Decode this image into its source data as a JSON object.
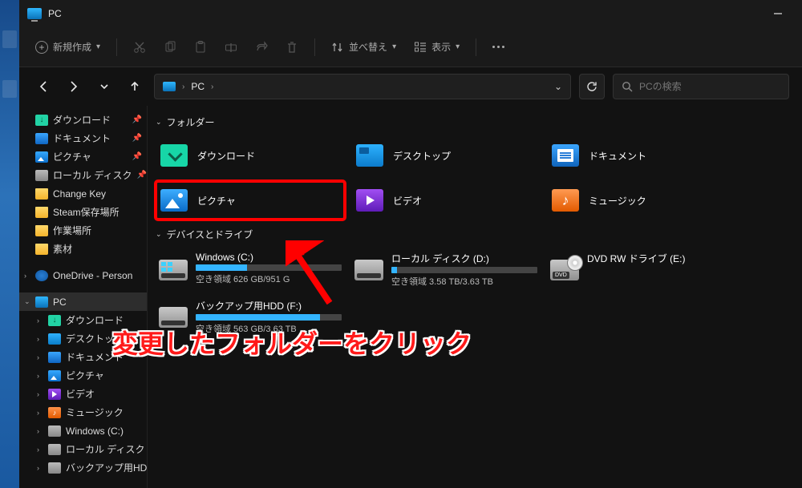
{
  "title": "PC",
  "toolbar": {
    "new": "新規作成",
    "sort": "並べ替え",
    "view": "表示"
  },
  "breadcrumb": {
    "label": "PC",
    "sep": "›"
  },
  "search": {
    "placeholder": "PCの検索"
  },
  "sidebar": {
    "quick": [
      {
        "label": "ダウンロード",
        "icon": "icon-download",
        "pinned": true
      },
      {
        "label": "ドキュメント",
        "icon": "icon-doc",
        "pinned": true
      },
      {
        "label": "ピクチャ",
        "icon": "icon-pic",
        "pinned": true
      },
      {
        "label": "ローカル ディスク",
        "icon": "icon-disk",
        "pinned": true
      },
      {
        "label": "Change Key",
        "icon": "folder-yellow"
      },
      {
        "label": "Steam保存場所",
        "icon": "folder-yellow"
      },
      {
        "label": "作業場所",
        "icon": "folder-yellow"
      },
      {
        "label": "素材",
        "icon": "folder-yellow"
      }
    ],
    "onedrive": "OneDrive - Person",
    "pc": "PC",
    "pc_children": [
      {
        "label": "ダウンロード",
        "icon": "icon-download"
      },
      {
        "label": "デスクトップ",
        "icon": "icon-desk"
      },
      {
        "label": "ドキュメント",
        "icon": "icon-doc"
      },
      {
        "label": "ピクチャ",
        "icon": "icon-pic"
      },
      {
        "label": "ビデオ",
        "icon": "icon-video"
      },
      {
        "label": "ミュージック",
        "icon": "icon-music"
      },
      {
        "label": "Windows (C:)",
        "icon": "icon-disk"
      },
      {
        "label": "ローカル ディスク (D",
        "icon": "icon-disk"
      },
      {
        "label": "バックアップ用HD",
        "icon": "icon-disk"
      }
    ]
  },
  "groups": {
    "folders": "フォルダー",
    "drives": "デバイスとドライブ"
  },
  "folders": [
    {
      "label": "ダウンロード",
      "icon": "big-download"
    },
    {
      "label": "デスクトップ",
      "icon": "big-desk"
    },
    {
      "label": "ドキュメント",
      "icon": "big-doc"
    },
    {
      "label": "ピクチャ",
      "icon": "big-pic",
      "highlighted": true
    },
    {
      "label": "ビデオ",
      "icon": "big-video"
    },
    {
      "label": "ミュージック",
      "icon": "big-music"
    }
  ],
  "drives": [
    {
      "name": "Windows (C:)",
      "sub": "空き領域 626 GB/951 G",
      "fill": 35,
      "kind": "win"
    },
    {
      "name": "ローカル ディスク (D:)",
      "sub": "空き領域 3.58 TB/3.63 TB",
      "fill": 4,
      "kind": "hdd"
    },
    {
      "name": "DVD RW ドライブ (E:)",
      "sub": "",
      "fill": null,
      "kind": "dvd"
    },
    {
      "name": "バックアップ用HDD (F:)",
      "sub": "空き領域 563 GB/3.63 TB",
      "fill": 85,
      "kind": "hdd"
    }
  ],
  "annotation": "変更したフォルダーをクリック"
}
